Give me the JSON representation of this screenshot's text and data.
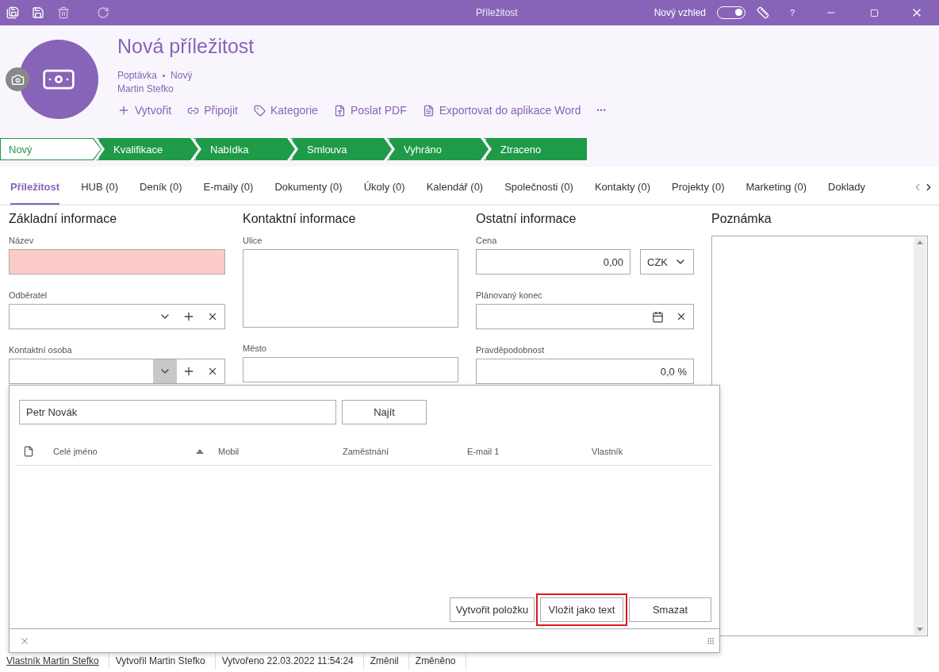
{
  "window": {
    "title": "Příležitost",
    "new_look_label": "Nový vzhled",
    "new_look_on": true,
    "help": "?"
  },
  "header": {
    "title": "Nová příležitost",
    "type": "Poptávka",
    "state": "Nový",
    "owner": "Martin Stefko",
    "actions": [
      {
        "kind": "create",
        "label": "Vytvořit"
      },
      {
        "kind": "attach",
        "label": "Připojit"
      },
      {
        "kind": "category",
        "label": "Kategorie"
      },
      {
        "kind": "pdf",
        "label": "Poslat PDF"
      },
      {
        "kind": "word",
        "label": "Exportovat do aplikace Word"
      },
      {
        "kind": "more",
        "label": "•••"
      }
    ]
  },
  "stages": [
    {
      "label": "Nový",
      "selected": true
    },
    {
      "label": "Kvalifikace",
      "selected": false
    },
    {
      "label": "Nabídka",
      "selected": false
    },
    {
      "label": "Smlouva",
      "selected": false
    },
    {
      "label": "Vyhráno",
      "selected": false
    },
    {
      "label": "Ztraceno",
      "selected": false
    }
  ],
  "tabs": [
    {
      "label": "Příležitost",
      "selected": true
    },
    {
      "label": "HUB (0)",
      "selected": false
    },
    {
      "label": "Deník (0)",
      "selected": false
    },
    {
      "label": "E-maily (0)",
      "selected": false
    },
    {
      "label": "Dokumenty (0)",
      "selected": false
    },
    {
      "label": "Úkoly (0)",
      "selected": false
    },
    {
      "label": "Kalendář (0)",
      "selected": false
    },
    {
      "label": "Společnosti (0)",
      "selected": false
    },
    {
      "label": "Kontakty (0)",
      "selected": false
    },
    {
      "label": "Projekty (0)",
      "selected": false
    },
    {
      "label": "Marketing (0)",
      "selected": false
    },
    {
      "label": "Doklady",
      "selected": false
    }
  ],
  "sections": [
    {
      "title": "Základní informace",
      "fields": [
        {
          "kind": "text",
          "label": "Název",
          "required": true
        },
        {
          "kind": "lookup",
          "label": "Odběratel",
          "open": false
        },
        {
          "kind": "lookup",
          "label": "Kontaktní osoba",
          "open": true
        }
      ]
    },
    {
      "title": "Kontaktní informace",
      "fields": [
        {
          "kind": "area",
          "label": "Ulice"
        },
        {
          "kind": "text",
          "label": "Město",
          "required": false
        }
      ]
    },
    {
      "title": "Ostatní informace",
      "fields": [
        {
          "kind": "money",
          "label": "Cena",
          "value": "0,00",
          "currency": "CZK"
        },
        {
          "kind": "date",
          "label": "Plánovaný konec"
        },
        {
          "kind": "number",
          "label": "Pravděpodobnost",
          "value": "0,0 %"
        }
      ]
    },
    {
      "title": "Poznámka",
      "fields": [
        {
          "kind": "note"
        }
      ]
    }
  ],
  "popup": {
    "search_value": "Petr Novák",
    "search_button": "Najít",
    "columns": [
      {
        "label": "Celé jméno",
        "sorted": true
      },
      {
        "label": "Mobil",
        "sorted": false
      },
      {
        "label": "Zaměstnání",
        "sorted": false
      },
      {
        "label": "E-mail 1",
        "sorted": false
      },
      {
        "label": "Vlastník",
        "sorted": false
      }
    ],
    "buttons": [
      {
        "label": "Vytvořit položku",
        "highlighted": false
      },
      {
        "label": "Vložit jako text",
        "highlighted": true
      },
      {
        "label": "Smazat",
        "highlighted": false
      }
    ]
  },
  "status_bar": [
    {
      "kind": "link",
      "text": "Vlastník Martin Stefko"
    },
    {
      "kind": "text",
      "text": "Vytvořil Martin Stefko"
    },
    {
      "kind": "text",
      "text": "Vytvořeno 22.03.2022 11:54:24"
    },
    {
      "kind": "text",
      "text": "Změnil"
    },
    {
      "kind": "text",
      "text": "Změněno"
    }
  ]
}
